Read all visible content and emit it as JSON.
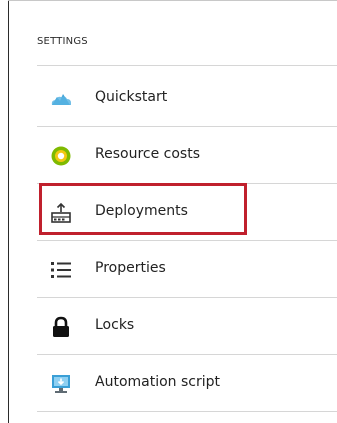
{
  "settings": {
    "header": "SETTINGS",
    "items": [
      {
        "label": "Quickstart",
        "icon": "quickstart-cloud-icon",
        "icon_color": "#3a9fd6"
      },
      {
        "label": "Resource costs",
        "icon": "resource-costs-icon",
        "icon_color": "#7fba00"
      },
      {
        "label": "Deployments",
        "icon": "deployments-icon",
        "icon_color": "#333333"
      },
      {
        "label": "Properties",
        "icon": "properties-list-icon",
        "icon_color": "#333333"
      },
      {
        "label": "Locks",
        "icon": "lock-icon",
        "icon_color": "#111111"
      },
      {
        "label": "Automation script",
        "icon": "automation-script-icon",
        "icon_color": "#3a9fd6"
      }
    ]
  },
  "highlight": {
    "item": "Deployments",
    "color": "#c0202d"
  }
}
